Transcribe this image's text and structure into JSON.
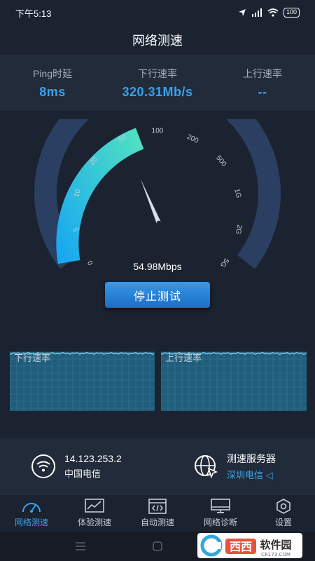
{
  "status_bar": {
    "time": "下午5:13",
    "battery": "100"
  },
  "header": {
    "title": "网络测速"
  },
  "stats": [
    {
      "label": "Ping时延",
      "value": "8ms"
    },
    {
      "label": "下行速率",
      "value": "320.31Mb/s"
    },
    {
      "label": "上行速率",
      "value": "--"
    }
  ],
  "gauge": {
    "ticks": [
      "0",
      "5",
      "10",
      "20",
      "50",
      "100",
      "200",
      "500",
      "1G",
      "2G",
      "5G"
    ],
    "reading": "54.98Mbps",
    "needle_value_mbps": 54.98
  },
  "actions": {
    "stop_label": "停止测试"
  },
  "graphs": {
    "download_label": "下行速率",
    "upload_label": "上行速率"
  },
  "info": {
    "ip": "14.123.253.2",
    "isp": "中国电信",
    "server_title": "测速服务器",
    "server_name": "深圳电信 ◁"
  },
  "nav": [
    {
      "label": "网络测速",
      "icon": "speedometer-icon",
      "active": true
    },
    {
      "label": "体验测速",
      "icon": "chart-icon",
      "active": false
    },
    {
      "label": "自动测速",
      "icon": "code-window-icon",
      "active": false
    },
    {
      "label": "网络诊断",
      "icon": "monitor-icon",
      "active": false
    },
    {
      "label": "设置",
      "icon": "settings-hexagon-icon",
      "active": false
    }
  ],
  "colors": {
    "accent": "#37a3ec",
    "background": "#1b2230",
    "panel": "#222b3a",
    "gauge_start": "#1ab8ef",
    "gauge_end": "#4fe0c2"
  },
  "watermark": {
    "text": "西西软件园",
    "sub": "CR173.COM"
  }
}
